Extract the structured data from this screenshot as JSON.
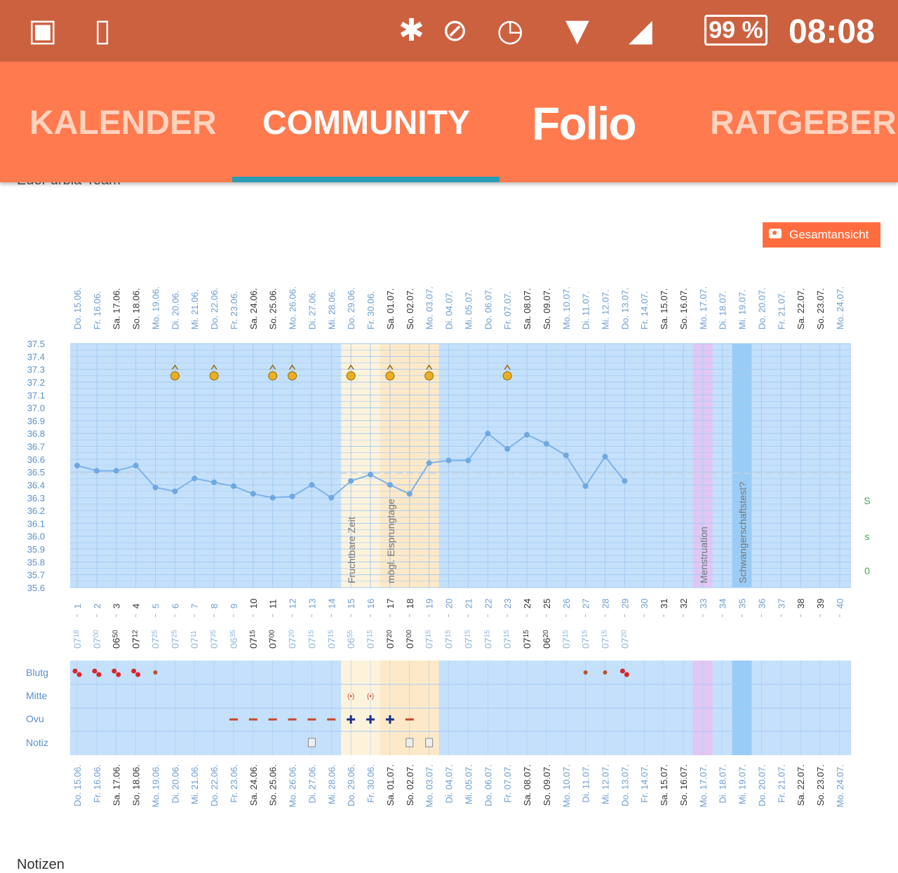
{
  "status_bar": {
    "icons": [
      "image-icon",
      "sd-card-icon",
      "bluetooth-icon",
      "do-not-disturb-icon",
      "alarm-icon",
      "wifi-icon",
      "signal-icon"
    ],
    "battery": "99 %",
    "time": "08:08"
  },
  "nav": {
    "tabs": [
      "KALENDER",
      "COMMUNITY",
      "RATGEBER"
    ],
    "active": "COMMUNITY",
    "logo": "Folio"
  },
  "cut_text": "Euer urbia-Team",
  "overview_button": "Gesamtansicht",
  "notes_heading": "Notizen",
  "colors": {
    "chart_bg": "#c4e0fb",
    "grid": "#a6ccf2",
    "line": "#7fb3e6",
    "fertile": "#fdf3dc",
    "ovulation": "#fde9c8",
    "menstruation": "#e2c6f4",
    "pregnancy_test": "#99cdf7",
    "accent": "#ff7a4e",
    "active_tab": "#2a9db5"
  },
  "chart_data": {
    "type": "line",
    "dates": [
      "Do. 15.06.",
      "Fr. 16.06.",
      "Sa. 17.06.",
      "So. 18.06.",
      "Mo. 19.06.",
      "Di. 20.06.",
      "Mi. 21.06.",
      "Do. 22.06.",
      "Fr. 23.06.",
      "Sa. 24.06.",
      "So. 25.06.",
      "Mo. 26.06.",
      "Di. 27.06.",
      "Mi. 28.06.",
      "Do. 29.06.",
      "Fr. 30.06.",
      "Sa. 01.07.",
      "So. 02.07.",
      "Mo. 03.07.",
      "Di. 04.07.",
      "Mi. 05.07.",
      "Do. 06.07.",
      "Fr. 07.07.",
      "Sa. 08.07.",
      "So. 09.07.",
      "Mo. 10.07.",
      "Di. 11.07.",
      "Mi. 12.07.",
      "Do. 13.07.",
      "Fr. 14.07.",
      "Sa. 15.07.",
      "So. 16.07.",
      "Mo. 17.07.",
      "Di. 18.07.",
      "Mi. 19.07.",
      "Do. 20.07.",
      "Fr. 21.07.",
      "Sa. 22.07.",
      "So. 23.07.",
      "Mo. 24.07."
    ],
    "cycle_days": [
      "1",
      "2",
      "3",
      "4",
      "5",
      "6",
      "7",
      "8",
      "9",
      "10",
      "11",
      "12",
      "13",
      "14",
      "15",
      "16",
      "17",
      "18",
      "19",
      "20",
      "21",
      "22",
      "23",
      "24",
      "25",
      "26",
      "27",
      "28",
      "29",
      "30",
      "31",
      "32",
      "33",
      "34",
      "35",
      "36",
      "37",
      "38",
      "39",
      "40"
    ],
    "times": [
      "0718",
      "0700",
      "0650",
      "0712",
      "0725",
      "0725",
      "0711",
      "0735",
      "0635",
      "0715",
      "0700",
      "0720",
      "0715",
      "0715",
      "0655",
      "0715",
      "0720",
      "0700",
      "0715",
      "0715",
      "0715",
      "0715",
      "0715",
      "0715",
      "0620",
      "0715",
      "0715",
      "0715",
      "0720"
    ],
    "temperatures": [
      36.55,
      36.51,
      36.51,
      36.55,
      36.38,
      36.35,
      36.45,
      36.42,
      36.39,
      36.33,
      36.3,
      36.31,
      36.4,
      36.3,
      36.43,
      36.48,
      36.4,
      36.33,
      36.57,
      36.59,
      36.59,
      36.8,
      36.68,
      36.79,
      36.72,
      36.63,
      36.39,
      36.62,
      36.43
    ],
    "y_ticks": [
      "35.6",
      "35.7",
      "35.8",
      "35.9",
      "36.0",
      "36.1",
      "36.2",
      "36.3",
      "36.4",
      "36.5",
      "36.6",
      "36.7",
      "36.8",
      "36.9",
      "37.0",
      "37.1",
      "37.2",
      "37.3",
      "37.4",
      "37.5"
    ],
    "ylim": [
      35.6,
      37.5
    ],
    "coverline": 36.49,
    "grid": true,
    "bands": [
      {
        "label": "Fruchtbare Zeit",
        "days": [
          15,
          16
        ],
        "color": "#fdf3dc"
      },
      {
        "label": "mögl. Eisprungtage",
        "days": [
          17,
          19
        ],
        "color": "#fde9c8"
      },
      {
        "label": "Menstruation",
        "days": [
          33,
          33
        ],
        "color": "#e2c6f4"
      },
      {
        "label": "Schwangerschaftstest?",
        "days": [
          35,
          35
        ],
        "color": "#99cdf7"
      }
    ],
    "intercourse_markers_days": [
      6,
      8,
      11,
      12,
      15,
      17,
      19,
      23
    ],
    "right_labels": [
      "S",
      "s",
      "0"
    ],
    "rows": [
      "Blutg",
      "Mitte",
      "Ovu",
      "Notiz"
    ],
    "bleeding": [
      {
        "day": 1,
        "level": "strong"
      },
      {
        "day": 2,
        "level": "strong"
      },
      {
        "day": 3,
        "level": "strong"
      },
      {
        "day": 4,
        "level": "strong"
      },
      {
        "day": 5,
        "level": "light"
      },
      {
        "day": 27,
        "level": "light"
      },
      {
        "day": 28,
        "level": "light"
      },
      {
        "day": 29,
        "level": "strong"
      }
    ],
    "mittelschmerz_days": [
      15,
      16
    ],
    "mittelschmerz_symbol": "(•)",
    "ovulation_test": [
      {
        "day": 9,
        "result": "negative"
      },
      {
        "day": 10,
        "result": "negative"
      },
      {
        "day": 11,
        "result": "negative"
      },
      {
        "day": 12,
        "result": "negative"
      },
      {
        "day": 13,
        "result": "negative"
      },
      {
        "day": 14,
        "result": "negative"
      },
      {
        "day": 15,
        "result": "positive"
      },
      {
        "day": 16,
        "result": "positive"
      },
      {
        "day": 17,
        "result": "positive"
      },
      {
        "day": 18,
        "result": "negative"
      }
    ],
    "note_days": [
      13,
      18,
      19
    ]
  }
}
